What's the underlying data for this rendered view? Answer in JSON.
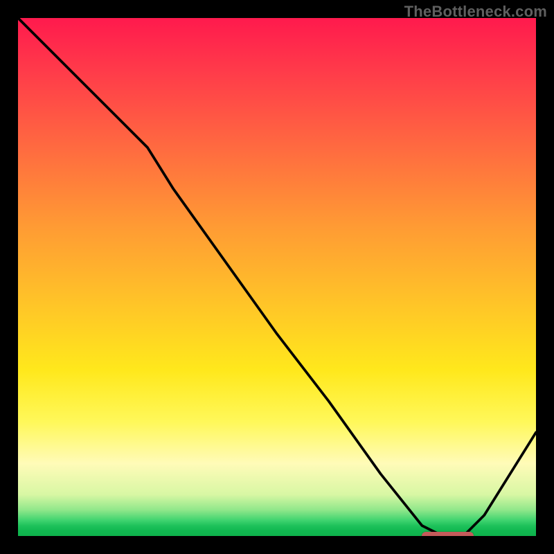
{
  "watermark_text": "TheBottleneck.com",
  "marker_color": "#c45a5a",
  "chart_data": {
    "type": "line",
    "title": "",
    "xlabel": "",
    "ylabel": "",
    "xlim": [
      0,
      100
    ],
    "ylim": [
      0,
      100
    ],
    "x": [
      0,
      10,
      20,
      25,
      30,
      40,
      50,
      60,
      70,
      78,
      82,
      86,
      90,
      100
    ],
    "y": [
      100,
      90,
      80,
      75,
      67,
      53,
      39,
      26,
      12,
      2,
      0,
      0,
      4,
      20
    ],
    "minimum_marker": {
      "x_start": 78,
      "x_end": 88,
      "y": 0
    },
    "gradient_stops": [
      {
        "pos": 0,
        "color": "#ff1a4d"
      },
      {
        "pos": 25,
        "color": "#ff6a40"
      },
      {
        "pos": 55,
        "color": "#ffc428"
      },
      {
        "pos": 78,
        "color": "#fff85a"
      },
      {
        "pos": 92,
        "color": "#d8f7a4"
      },
      {
        "pos": 100,
        "color": "#0fb24c"
      }
    ]
  }
}
